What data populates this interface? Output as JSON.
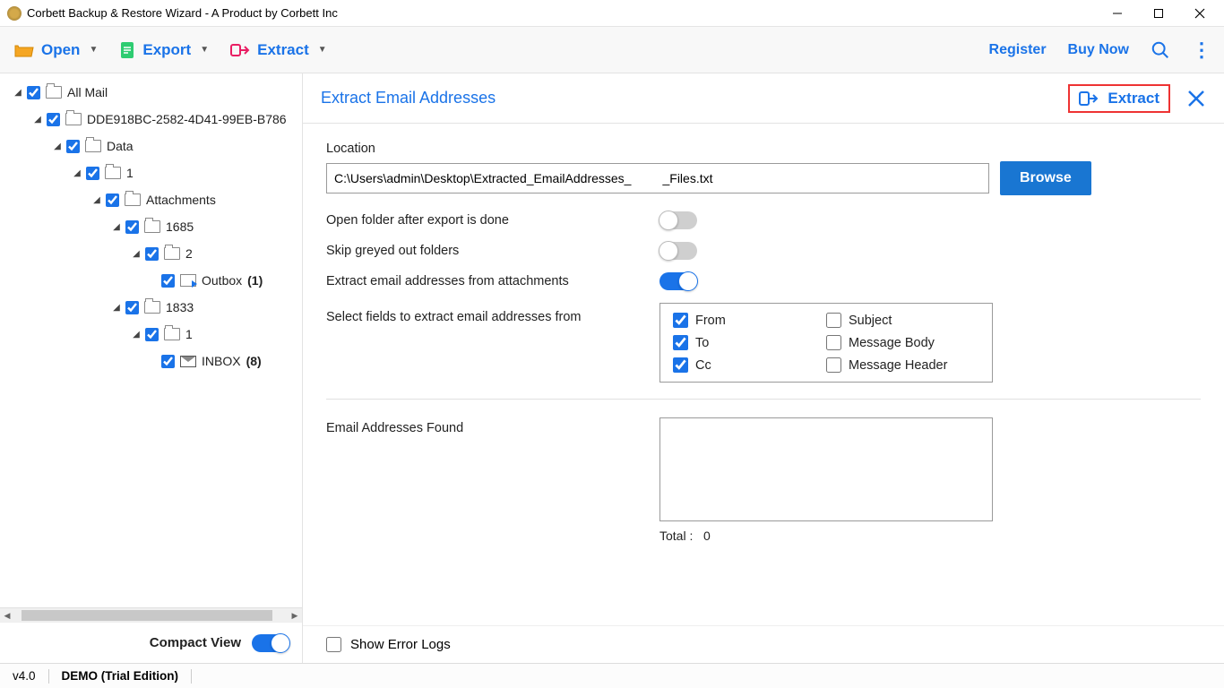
{
  "window": {
    "title": "Corbett Backup & Restore Wizard - A Product by Corbett Inc"
  },
  "toolbar": {
    "open": "Open",
    "export": "Export",
    "extract": "Extract",
    "register": "Register",
    "buy_now": "Buy Now"
  },
  "tree": {
    "root": "All Mail",
    "guid": "DDE918BC-2582-4D41-99EB-B786",
    "data": "Data",
    "n1a": "1",
    "attachments": "Attachments",
    "f1685": "1685",
    "n2": "2",
    "outbox": "Outbox",
    "outbox_count": "(1)",
    "f1833": "1833",
    "n1b": "1",
    "inbox": "INBOX",
    "inbox_count": "(8)"
  },
  "sidebar": {
    "compact_view": "Compact View"
  },
  "panel": {
    "title": "Extract Email Addresses",
    "extract_btn": "Extract",
    "location_label": "Location",
    "location_value": "C:\\Users\\admin\\Desktop\\Extracted_EmailAddresses_         _Files.txt",
    "browse": "Browse",
    "open_folder": "Open folder after export is done",
    "skip_greyed": "Skip greyed out folders",
    "extract_attach": "Extract email addresses from attachments",
    "select_fields": "Select fields to extract email addresses from",
    "fields": {
      "from": "From",
      "to": "To",
      "cc": "Cc",
      "subject": "Subject",
      "body": "Message Body",
      "header": "Message Header"
    },
    "found_label": "Email Addresses Found",
    "total_label": "Total :",
    "total_value": "0",
    "show_error_logs": "Show Error Logs"
  },
  "status": {
    "version": "v4.0",
    "edition": "DEMO (Trial Edition)"
  }
}
